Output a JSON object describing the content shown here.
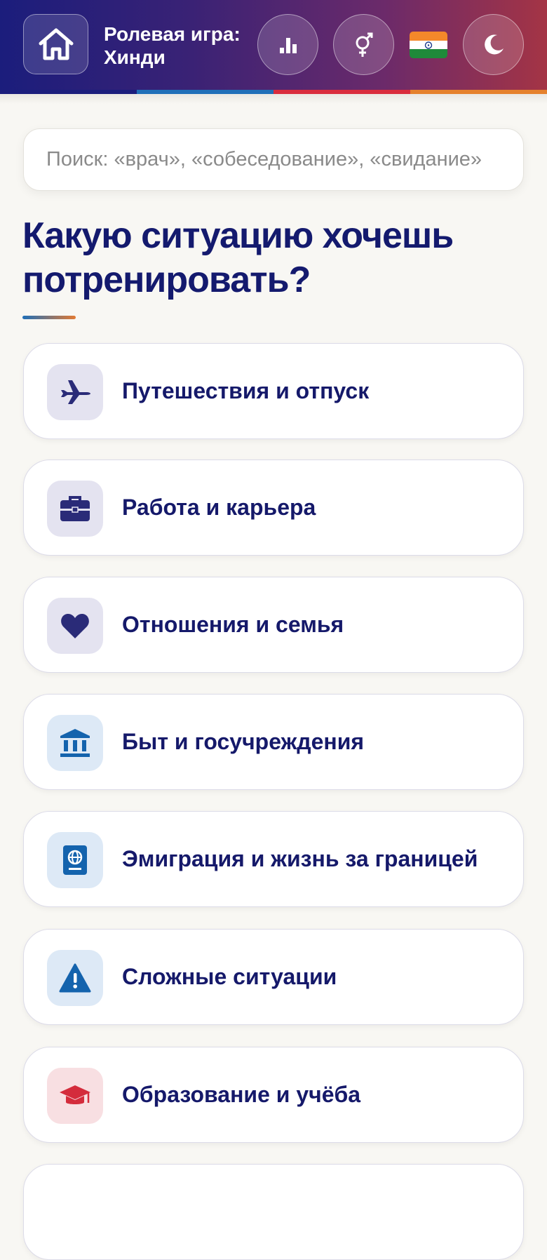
{
  "header": {
    "title": "Ролевая игра: Хинди",
    "home_icon": "home-icon",
    "buttons": [
      "stats-icon",
      "gender-icon",
      "india-flag-icon",
      "moon-icon"
    ],
    "stripe_colors": [
      "#1b1d7c",
      "#1f6fb8",
      "#d92c3d",
      "#e5812d"
    ]
  },
  "search": {
    "placeholder": "Поиск: «врач», «собеседование», «свидание»"
  },
  "heading": "Какую ситуацию хочешь потренировать?",
  "categories": [
    {
      "label": "Путешествия и отпуск",
      "icon": "airplane-icon",
      "bg": "#e4e3f0",
      "fg": "#2a2b78"
    },
    {
      "label": "Работа и карьера",
      "icon": "briefcase-icon",
      "bg": "#e4e3f0",
      "fg": "#2a2b78"
    },
    {
      "label": "Отношения и семья",
      "icon": "heart-icon",
      "bg": "#e4e3f0",
      "fg": "#2a2b78"
    },
    {
      "label": "Быт и госучреждения",
      "icon": "bank-icon",
      "bg": "#dde9f6",
      "fg": "#1463ad"
    },
    {
      "label": "Эмиграция и жизнь за границей",
      "icon": "passport-icon",
      "bg": "#dde9f6",
      "fg": "#1463ad"
    },
    {
      "label": "Сложные ситуации",
      "icon": "warning-icon",
      "bg": "#dde9f6",
      "fg": "#1463ad"
    },
    {
      "label": "Образование и учёба",
      "icon": "graduation-cap-icon",
      "bg": "#f8dfe2",
      "fg": "#d42c3c"
    }
  ]
}
